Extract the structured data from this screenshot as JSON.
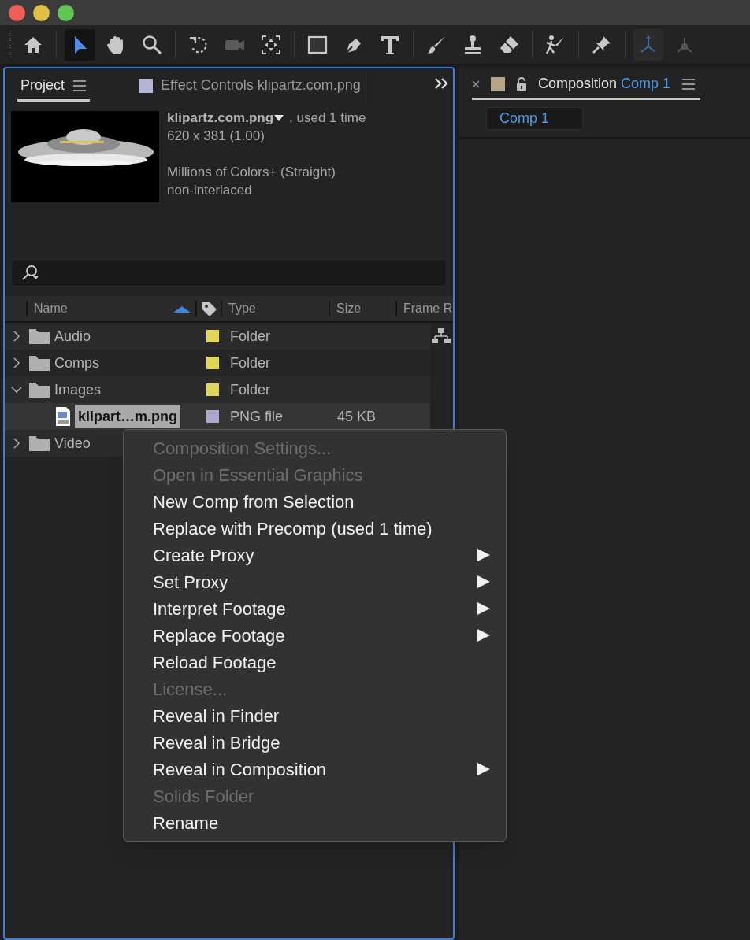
{
  "window": {
    "controls": [
      {
        "kind": "close"
      },
      {
        "kind": "minimize"
      },
      {
        "kind": "zoom"
      }
    ]
  },
  "tools": [
    {
      "kind": "home",
      "selected": false,
      "disabled": false
    },
    {
      "kind": "selection",
      "selected": true,
      "disabled": false
    },
    {
      "kind": "hand",
      "selected": false,
      "disabled": false
    },
    {
      "kind": "zoom",
      "selected": false,
      "disabled": false
    },
    {
      "kind": "rotate",
      "selected": false,
      "disabled": false
    },
    {
      "kind": "camera",
      "selected": false,
      "disabled": true
    },
    {
      "kind": "pan-behind",
      "selected": false,
      "disabled": false
    },
    {
      "kind": "rectangle",
      "selected": false,
      "disabled": false
    },
    {
      "kind": "pen",
      "selected": false,
      "disabled": false
    },
    {
      "kind": "type",
      "selected": false,
      "disabled": false
    },
    {
      "kind": "brush",
      "selected": false,
      "disabled": false
    },
    {
      "kind": "stamp",
      "selected": false,
      "disabled": false
    },
    {
      "kind": "eraser",
      "selected": false,
      "disabled": false
    },
    {
      "kind": "puppet",
      "selected": false,
      "disabled": false
    },
    {
      "kind": "pin",
      "selected": false,
      "disabled": false
    },
    {
      "kind": "axis-local",
      "selected": true,
      "disabled": true
    },
    {
      "kind": "axis-world",
      "selected": false,
      "disabled": true
    }
  ],
  "project_panel": {
    "tabs": [
      {
        "label": "Project",
        "selected": true
      },
      {
        "label": "Effect Controls klipartz.com.png",
        "selected": false,
        "color": "#b4b4d6"
      }
    ],
    "preview": {
      "kind": "picture",
      "name": "klipartz.com.png",
      "usage": ", used 1 time",
      "dimensions": "620 x 381 (1.00)",
      "color_info": "Millions of Colors+ (Straight)",
      "interlace": "non-interlaced"
    },
    "columns": [
      "Name",
      "Type",
      "Size",
      "Frame R"
    ],
    "items": [
      {
        "name": "Audio",
        "kind": "folder",
        "color": "#e0d75a",
        "type": "Folder",
        "expanded": false,
        "selected": false
      },
      {
        "name": "Comps",
        "kind": "folder",
        "color": "#e0d75a",
        "type": "Folder",
        "expanded": false,
        "selected": false
      },
      {
        "name": "Images",
        "kind": "folder",
        "color": "#e0d75a",
        "type": "Folder",
        "expanded": true,
        "selected": false,
        "children": [
          {
            "name": "klipart…m.png",
            "kind": "png",
            "color": "#a9a9cc",
            "type": "PNG file",
            "size": "45 KB",
            "selected": true
          }
        ]
      },
      {
        "name": "Video",
        "kind": "folder",
        "expanded": false,
        "selected": false
      }
    ]
  },
  "composition_panel": {
    "tab": {
      "prefix": "Composition",
      "name": "Comp 1",
      "color": "#b3a586",
      "selected": true
    },
    "comp_tabs": [
      {
        "label": "Comp 1",
        "selected": true
      }
    ]
  },
  "context_menu": [
    {
      "label": "Composition Settings...",
      "disabled": true,
      "submenu": false
    },
    {
      "label": "Open in Essential Graphics",
      "disabled": true,
      "submenu": false
    },
    {
      "label": "New Comp from Selection",
      "disabled": false,
      "submenu": false
    },
    {
      "label": "Replace with Precomp (used 1 time)",
      "disabled": false,
      "submenu": false
    },
    {
      "label": "Create Proxy",
      "disabled": false,
      "submenu": true
    },
    {
      "label": "Set Proxy",
      "disabled": false,
      "submenu": true
    },
    {
      "label": "Interpret Footage",
      "disabled": false,
      "submenu": true
    },
    {
      "label": "Replace Footage",
      "disabled": false,
      "submenu": true
    },
    {
      "label": "Reload Footage",
      "disabled": false,
      "submenu": false
    },
    {
      "label": "License...",
      "disabled": true,
      "submenu": false
    },
    {
      "label": "Reveal in Finder",
      "disabled": false,
      "submenu": false
    },
    {
      "label": "Reveal in Bridge",
      "disabled": false,
      "submenu": false
    },
    {
      "label": "Reveal in Composition",
      "disabled": false,
      "submenu": true
    },
    {
      "label": "Solids Folder",
      "disabled": true,
      "submenu": false
    },
    {
      "label": "Rename",
      "disabled": false,
      "submenu": false
    }
  ]
}
